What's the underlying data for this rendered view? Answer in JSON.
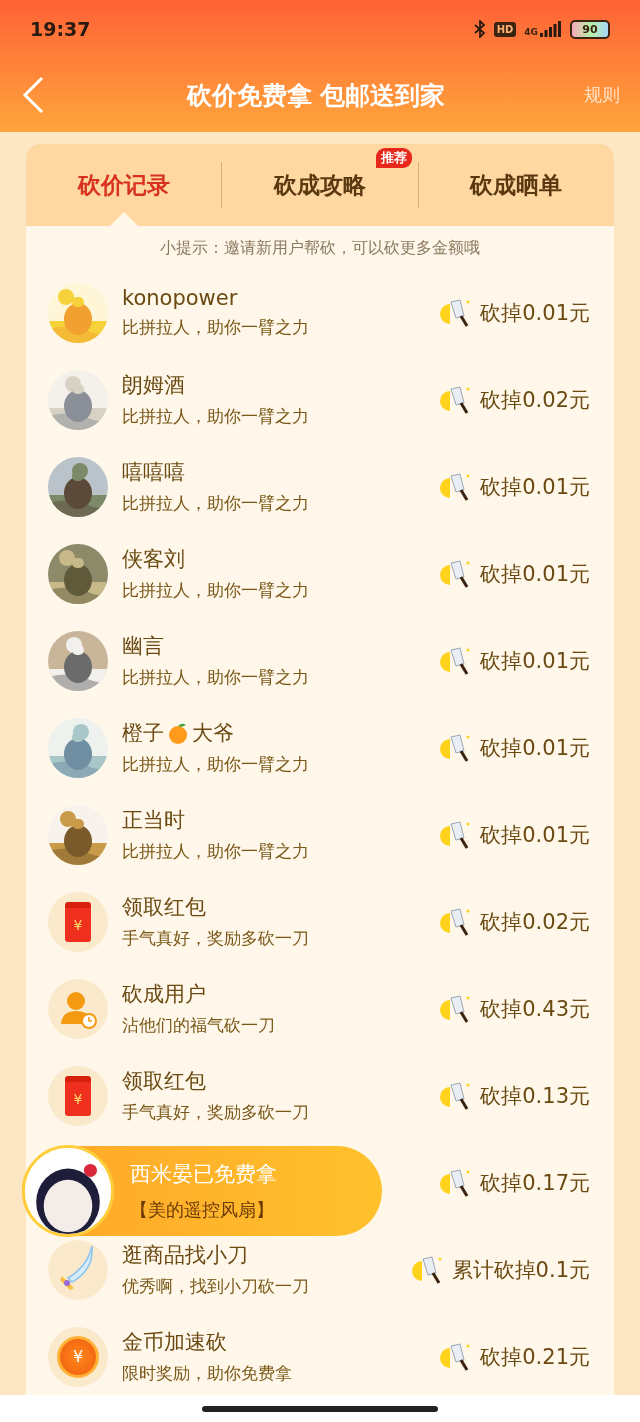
{
  "status_bar": {
    "time": "19:37",
    "hd": "HD",
    "network": "4G",
    "battery": "90"
  },
  "nav": {
    "title": "砍价免费拿 包邮送到家",
    "rules": "规则"
  },
  "tabs": [
    {
      "label": "砍价记录",
      "selected": true
    },
    {
      "label": "砍成攻略",
      "selected": false,
      "badge": "推荐"
    },
    {
      "label": "砍成晒单",
      "selected": false
    }
  ],
  "hint": "小提示：邀请新用户帮砍，可以砍更多金额哦",
  "records": [
    {
      "kind": "picture",
      "name": "konopower",
      "desc": "比拼拉人，助你一臂之力",
      "amount": "砍掉0.01元"
    },
    {
      "kind": "picture",
      "name": "朗姆酒",
      "desc": "比拼拉人，助你一臂之力",
      "amount": "砍掉0.02元"
    },
    {
      "kind": "picture",
      "name": "嘻嘻嘻",
      "desc": "比拼拉人，助你一臂之力",
      "amount": "砍掉0.01元"
    },
    {
      "kind": "picture",
      "name": "侠客刘",
      "desc": "比拼拉人，助你一臂之力",
      "amount": "砍掉0.01元"
    },
    {
      "kind": "picture",
      "name": "幽言",
      "desc": "比拼拉人，助你一臂之力",
      "amount": "砍掉0.01元"
    },
    {
      "kind": "picture",
      "name": "橙子",
      "name_emoji": true,
      "name_suffix": "大爷",
      "desc": "比拼拉人，助你一臂之力",
      "amount": "砍掉0.01元"
    },
    {
      "kind": "picture",
      "name": "正当时",
      "desc": "比拼拉人，助你一臂之力",
      "amount": "砍掉0.01元"
    },
    {
      "kind": "redpacket",
      "symbol": "¥",
      "name": "领取红包",
      "desc": "手气真好，奖励多砍一刀",
      "amount": "砍掉0.02元"
    },
    {
      "kind": "user",
      "name": "砍成用户",
      "desc": "沾他们的福气砍一刀",
      "amount": "砍掉0.43元"
    },
    {
      "kind": "redpacket",
      "symbol": "¥",
      "name": "领取红包",
      "desc": "手气真好，奖励多砍一刀",
      "amount": "砍掉0.13元"
    },
    {
      "amount": "砍掉0.17元"
    },
    {
      "kind": "knife",
      "name": "逛商品找小刀",
      "desc": "优秀啊，找到小刀砍一刀",
      "amount": "累计砍掉0.1元"
    },
    {
      "kind": "coin",
      "symbol": "¥",
      "name": "金币加速砍",
      "desc": "限时奖励，助你免费拿",
      "amount": "砍掉0.21元"
    }
  ],
  "toast": {
    "title": "西米晏已免费拿",
    "product": "【美的遥控风扇】"
  }
}
